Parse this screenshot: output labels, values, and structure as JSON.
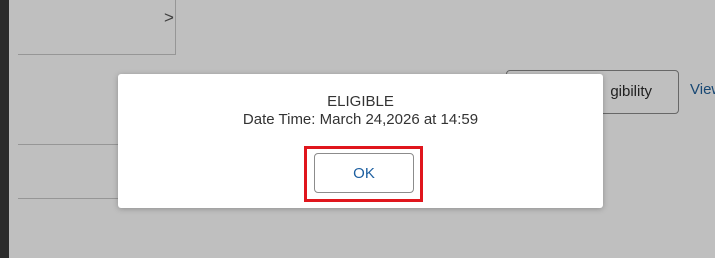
{
  "background": {
    "chevron_icon": "chevron-right-icon",
    "chevron_glyph": ">",
    "button_label_visible": "gibility",
    "link_label_visible": "View"
  },
  "modal": {
    "status": "ELIGIBLE",
    "datetime": "Date Time: March 24,2026 at 14:59",
    "ok_label": "OK",
    "highlight_color": "#e0161d"
  }
}
